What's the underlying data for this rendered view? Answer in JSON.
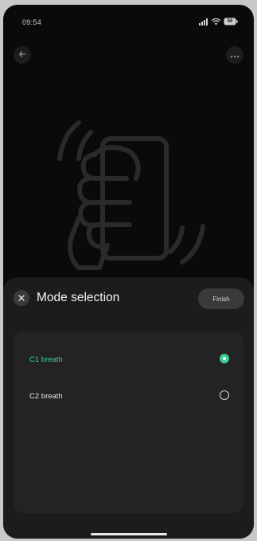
{
  "status_bar": {
    "time": "09:54",
    "battery": "50"
  },
  "nav": {
    "back_icon": "arrow-left-icon",
    "more_icon": "more-dots-icon"
  },
  "hero": {
    "icon": "hand-shake-phone-icon"
  },
  "sheet": {
    "title": "Mode selection",
    "finish_label": "Finish",
    "close_icon": "close-icon"
  },
  "options": [
    {
      "label": "C1 breath",
      "selected": true
    },
    {
      "label": "C2 breath",
      "selected": false
    }
  ],
  "colors": {
    "accent": "#3ecf8e",
    "background": "#0a0a0b",
    "sheet": "#1c1c1e",
    "card": "#232325"
  }
}
